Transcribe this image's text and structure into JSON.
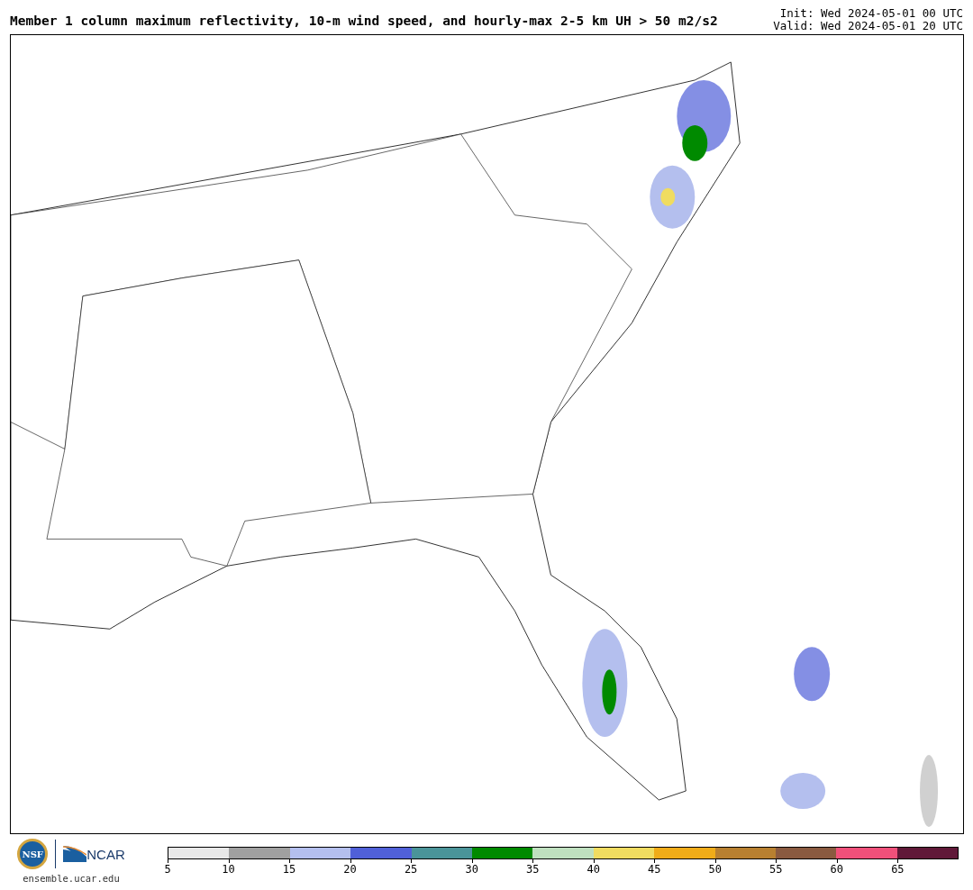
{
  "title": "Member 1 column maximum reflectivity, 10-m wind speed, and hourly-max 2-5 km UH > 50 m2/s2",
  "times": [
    "Init: Wed 2024-05-01 00 UTC",
    "Valid: Wed 2024-05-01 20 UTC"
  ],
  "logos": {
    "nsf": "NSF",
    "ncar": "NCAR",
    "url": "ensemble.ucar.edu"
  },
  "colorbar": {
    "bins": [
      {
        "color": "#e8e8e8"
      },
      {
        "color": "#a0a0a0"
      },
      {
        "color": "#b4bfee"
      },
      {
        "color": "#5060d8"
      },
      {
        "color": "#4a9499"
      },
      {
        "color": "#008a00"
      },
      {
        "color": "#bfe0bf"
      },
      {
        "color": "#f0dc60"
      },
      {
        "color": "#f0ac18"
      },
      {
        "color": "#b88030"
      },
      {
        "color": "#8a5a40"
      },
      {
        "color": "#f0507a"
      },
      {
        "color": "#601838"
      }
    ],
    "ticks": [
      "5",
      "10",
      "15",
      "20",
      "25",
      "30",
      "35",
      "40",
      "45",
      "50",
      "55",
      "60",
      "65"
    ]
  }
}
